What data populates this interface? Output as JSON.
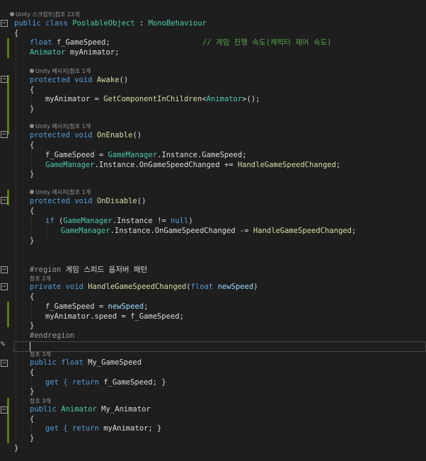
{
  "editor": {
    "language": "C#",
    "class_lens": "Unity 스크립트|참조 22개",
    "class_decl": {
      "kw1": "public",
      "kw2": "class",
      "name": "PoolableObject",
      "colon": ":",
      "base": "MonoBehaviour"
    },
    "field_speed": {
      "type": "float",
      "name": "f_GameSpeed;",
      "comment": "// 게임 진행 속도(캐릭터 제어 속도)"
    },
    "field_anim": {
      "type": "Animator",
      "name": "myAnimator;"
    },
    "awake_lens": "Unity 메시지|참조 1개",
    "awake_sig": {
      "kw1": "protected",
      "kw2": "void",
      "name": "Awake",
      "rest": "()"
    },
    "awake_body": {
      "target": "myAnimator",
      "op": " = ",
      "fn": "GetComponentInChildren",
      "lt": "<",
      "type": "Animator",
      "rest": ">();"
    },
    "enable_lens": "Unity 메시지|참조 1개",
    "enable_sig": {
      "kw1": "protected",
      "kw2": "void",
      "name": "OnEnable",
      "rest": "()"
    },
    "enable_line1": {
      "target": "f_GameSpeed",
      "op": " = ",
      "type": "GameManager",
      "rest": ".Instance.GameSpeed;"
    },
    "enable_line2": {
      "type": "GameManager",
      "mid": ".Instance.OnGameSpeedChanged += ",
      "fn": "HandleGameSpeedChanged",
      "end": ";"
    },
    "disable_lens": "Unity 메시지|참조 1개",
    "disable_sig": {
      "kw1": "protected",
      "kw2": "void",
      "name": "OnDisable",
      "rest": "()"
    },
    "disable_if": {
      "kw": "if",
      "open": " (",
      "type": "GameManager",
      "mid": ".Instance != ",
      "null": "null",
      "close": ")"
    },
    "disable_line": {
      "type": "GameManager",
      "mid": ".Instance.OnGameSpeedChanged -= ",
      "fn": "HandleGameSpeedChanged",
      "end": ";"
    },
    "region": {
      "directive": "#region",
      "label": "게임 스피드 옵저버 패턴"
    },
    "handler_lens": "참조 2개",
    "handler_sig": {
      "kw1": "private",
      "kw2": "void",
      "name": "HandleGameSpeedChanged",
      "open": "(",
      "ptype": "float",
      "pname": "newSpeed",
      "close": ")"
    },
    "handler_line1": {
      "target": "f_GameSpeed",
      "op": " = ",
      "param": "newSpeed",
      "end": ";"
    },
    "handler_line2": {
      "text": "myAnimator.speed = f_GameSpeed;"
    },
    "endregion": "#endregion",
    "prop1_lens": "참조 3개",
    "prop1_sig": {
      "kw1": "public",
      "type": "float",
      "name": "My_GameSpeed"
    },
    "prop1_body": {
      "open": "get { ",
      "kw": "return",
      "rest": " f_GameSpeed; }"
    },
    "prop2_lens": "참조 3개",
    "prop2_sig": {
      "kw1": "public",
      "type": "Animator",
      "name": "My_Animator"
    },
    "prop2_body": {
      "open": "get { ",
      "kw": "return",
      "rest": " myAnimator; }"
    },
    "brace_open": "{",
    "brace_close": "}"
  },
  "colors": {
    "background": "#1e1e1e",
    "keyword": "#569cd6",
    "type": "#4ec9b0",
    "method": "#dcdcaa",
    "variable": "#9cdcfe",
    "comment": "#57a64a",
    "change_bar": "#587c0c"
  },
  "icons": [
    "unity-icon",
    "fold-toggle-icon",
    "pencil-edit-icon"
  ]
}
